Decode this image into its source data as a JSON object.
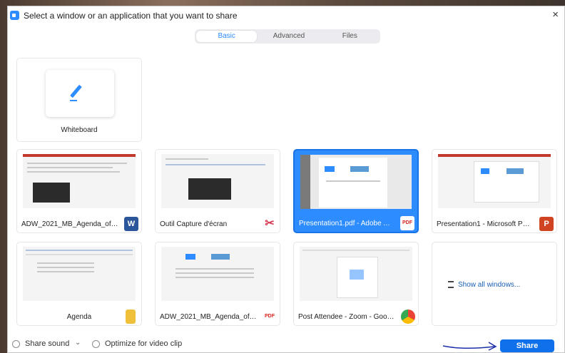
{
  "dialog": {
    "title": "Select a window or an application that you want to share",
    "close_glyph": "×"
  },
  "tabs": [
    {
      "label": "Basic",
      "active": true
    },
    {
      "label": "Advanced",
      "active": false
    },
    {
      "label": "Files",
      "active": false
    }
  ],
  "whiteboard": {
    "label": "Whiteboard",
    "icon": "pen-icon"
  },
  "windows": [
    {
      "label": "ADW_2021_MB_Agenda_official_i...",
      "app": "word",
      "icon_text": "W",
      "color": "#2b579a",
      "selected": false
    },
    {
      "label": "Outil Capture d'écran",
      "app": "snipping-tool",
      "icon_text": "✂",
      "color": "#d83b52",
      "selected": false
    },
    {
      "label": "Presentation1.pdf - Adobe Acrob...",
      "app": "acrobat",
      "icon_text": "PDF",
      "color": "#d4251c",
      "selected": true
    },
    {
      "label": "Presentation1 - Microsoft Power...",
      "app": "powerpoint",
      "icon_text": "P",
      "color": "#d04423",
      "selected": false
    },
    {
      "label": "Agenda",
      "app": "file-explorer",
      "icon_text": "",
      "color": "#f0c03a",
      "selected": false
    },
    {
      "label": "ADW_2021_MB_Agenda_official_f...",
      "app": "acrobat",
      "icon_text": "PDF",
      "color": "#d4251c",
      "selected": false
    },
    {
      "label": "Post Attendee - Zoom - Google ...",
      "app": "chrome",
      "icon_text": "",
      "color": "#4285f4",
      "selected": false
    }
  ],
  "show_all": {
    "label": "Show all windows..."
  },
  "footer": {
    "share_sound": "Share sound",
    "dropdown": "⌄",
    "optimize": "Optimize for video clip",
    "share_button": "Share"
  },
  "colors": {
    "accent": "#2d8cff",
    "share": "#0e71eb"
  }
}
